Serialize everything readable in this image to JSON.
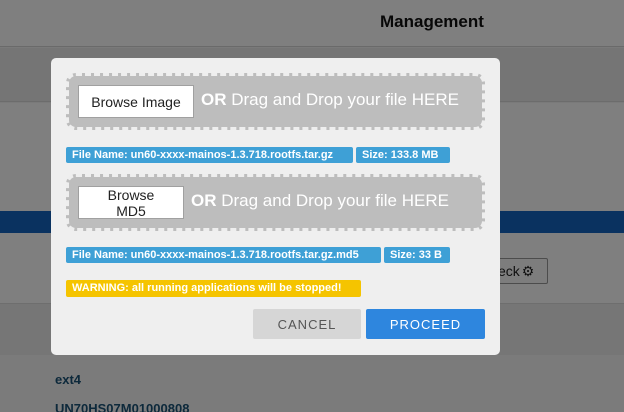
{
  "background": {
    "title": "Management",
    "check_label": "eck",
    "filesystem": "ext4",
    "serial": "UN70HS07M01000808"
  },
  "modal": {
    "image_zone": {
      "browse_label": "Browse Image",
      "or": "OR",
      "drag_text": " Drag and Drop your file HERE",
      "file_name": "File Name: un60-xxxx-mainos-1.3.718.rootfs.tar.gz",
      "size": "Size: 133.8 MB"
    },
    "md5_zone": {
      "browse_label": "Browse MD5",
      "or": "OR",
      "drag_text": " Drag and Drop your file HERE",
      "file_name": "File Name: un60-xxxx-mainos-1.3.718.rootfs.tar.gz.md5",
      "size": "Size: 33 B"
    },
    "warning": "WARNING: all running applications will be stopped!",
    "cancel_label": "CANCEL",
    "proceed_label": "PROCEED"
  },
  "colors": {
    "accent": "#2e86de",
    "tag": "#3ea0d6",
    "warning": "#f5c400"
  }
}
